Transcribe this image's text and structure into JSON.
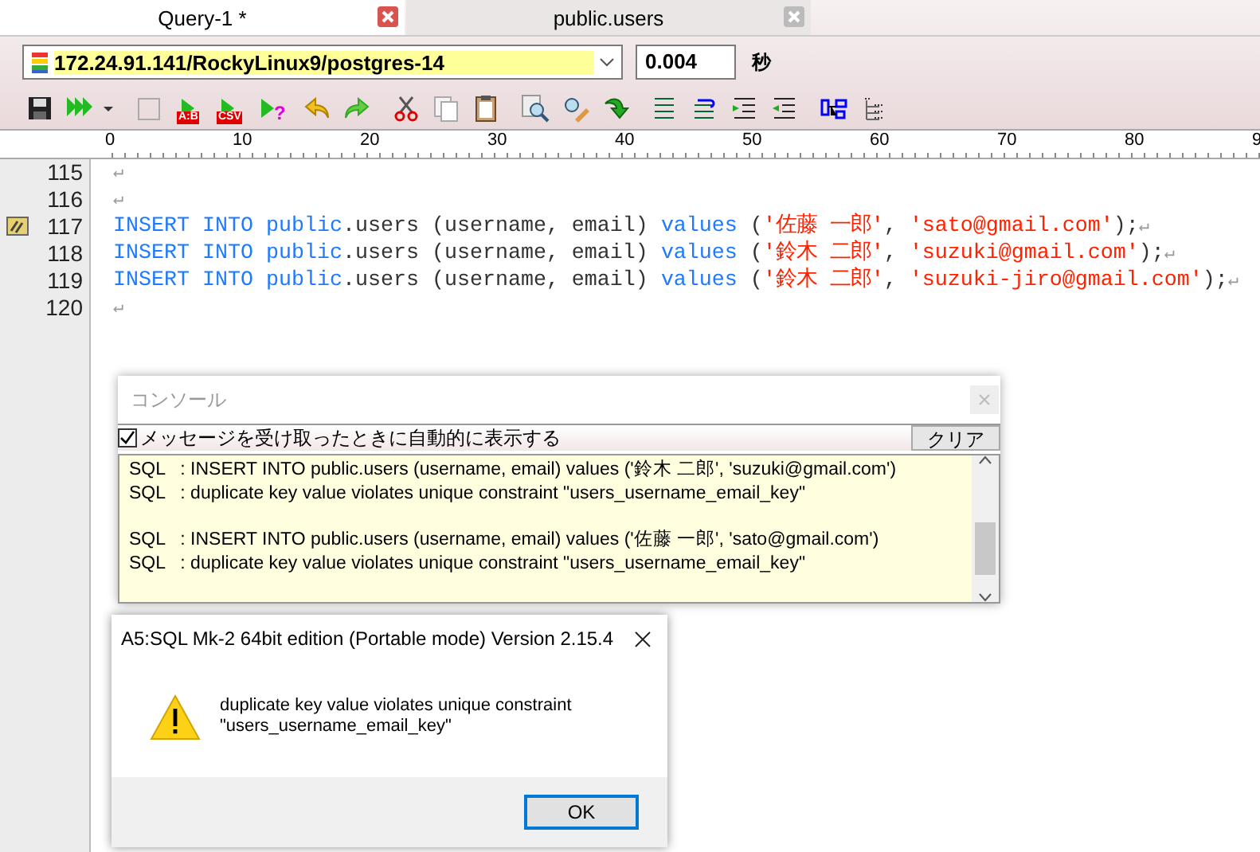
{
  "tabs": [
    {
      "label": "Query-1 *",
      "selected": true
    },
    {
      "label": "public.users",
      "selected": false
    }
  ],
  "connection": {
    "value": "172.24.91.141/RockyLinux9/postgres-14",
    "time": "0.004",
    "unit": "秒"
  },
  "toolbar": [
    {
      "kind": "save"
    },
    {
      "kind": "run"
    },
    {
      "kind": "square"
    },
    {
      "kind": "run-badge",
      "badge": "A:B"
    },
    {
      "kind": "run-badge",
      "badge": "CSV"
    },
    {
      "kind": "run-badge",
      "badge": "?"
    },
    {
      "kind": "undo"
    },
    {
      "kind": "redo"
    },
    {
      "kind": "cut"
    },
    {
      "kind": "copy"
    },
    {
      "kind": "paste"
    },
    {
      "kind": "search"
    },
    {
      "kind": "edit"
    },
    {
      "kind": "arrow-down"
    },
    {
      "kind": "lines"
    },
    {
      "kind": "lines-wrap"
    },
    {
      "kind": "indent"
    },
    {
      "kind": "outdent"
    },
    {
      "kind": "diagram"
    },
    {
      "kind": "tree"
    }
  ],
  "ruler": {
    "labels": [
      "0",
      "10",
      "20",
      "30",
      "40",
      "50",
      "60",
      "70",
      "80",
      "9"
    ]
  },
  "editor": {
    "lines": [
      {
        "number": "115",
        "bookmark": false,
        "tokens": [
          {
            "kind": "eol",
            "text": "↵"
          }
        ]
      },
      {
        "number": "116",
        "bookmark": false,
        "tokens": [
          {
            "kind": "eol",
            "text": "↵"
          }
        ]
      },
      {
        "number": "117",
        "bookmark": true,
        "tokens": [
          {
            "kind": "keyword",
            "text": "INSERT INTO public"
          },
          {
            "kind": "plain",
            "text": ".users (username, email) "
          },
          {
            "kind": "keyword",
            "text": "values"
          },
          {
            "kind": "plain",
            "text": " ("
          },
          {
            "kind": "string",
            "text": "'佐藤 一郎'"
          },
          {
            "kind": "plain",
            "text": ", "
          },
          {
            "kind": "string",
            "text": "'sato@gmail.com'"
          },
          {
            "kind": "plain",
            "text": ");"
          },
          {
            "kind": "eol",
            "text": "↵"
          }
        ]
      },
      {
        "number": "118",
        "bookmark": false,
        "tokens": [
          {
            "kind": "keyword",
            "text": "INSERT INTO public"
          },
          {
            "kind": "plain",
            "text": ".users (username, email) "
          },
          {
            "kind": "keyword",
            "text": "values"
          },
          {
            "kind": "plain",
            "text": " ("
          },
          {
            "kind": "string",
            "text": "'鈴木 二郎'"
          },
          {
            "kind": "plain",
            "text": ", "
          },
          {
            "kind": "string",
            "text": "'suzuki@gmail.com'"
          },
          {
            "kind": "plain",
            "text": ");"
          },
          {
            "kind": "eol",
            "text": "↵"
          }
        ]
      },
      {
        "number": "119",
        "bookmark": false,
        "tokens": [
          {
            "kind": "keyword",
            "text": "INSERT INTO public"
          },
          {
            "kind": "plain",
            "text": ".users (username, email) "
          },
          {
            "kind": "keyword",
            "text": "values"
          },
          {
            "kind": "plain",
            "text": " ("
          },
          {
            "kind": "string",
            "text": "'鈴木 二郎'"
          },
          {
            "kind": "plain",
            "text": ", "
          },
          {
            "kind": "string",
            "text": "'suzuki-jiro@gmail.com'"
          },
          {
            "kind": "plain",
            "text": ");"
          },
          {
            "kind": "eol",
            "text": "↵"
          }
        ]
      },
      {
        "number": "120",
        "bookmark": false,
        "tokens": [
          {
            "kind": "eol",
            "text": "↵"
          }
        ]
      }
    ]
  },
  "console": {
    "title": "コンソール",
    "auto_show": {
      "label": "メッセージを受け取ったときに自動的に表示する",
      "checked": true
    },
    "clear_button": "クリア",
    "messages": [
      {
        "lines": [
          "SQL   : INSERT INTO public.users (username, email) values ('鈴木 二郎', 'suzuki@gmail.com')",
          "SQL   : duplicate key value violates unique constraint \"users_username_email_key\""
        ]
      },
      {
        "lines": [
          "SQL   : INSERT INTO public.users (username, email) values ('佐藤 一郎', 'sato@gmail.com')",
          "SQL   : duplicate key value violates unique constraint \"users_username_email_key\""
        ]
      }
    ]
  },
  "dialog": {
    "title": "A5:SQL Mk-2 64bit edition (Portable mode) Version 2.15.4",
    "message": "duplicate key value violates unique constraint\n\"users_username_email_key\"",
    "ok_button": "OK"
  }
}
